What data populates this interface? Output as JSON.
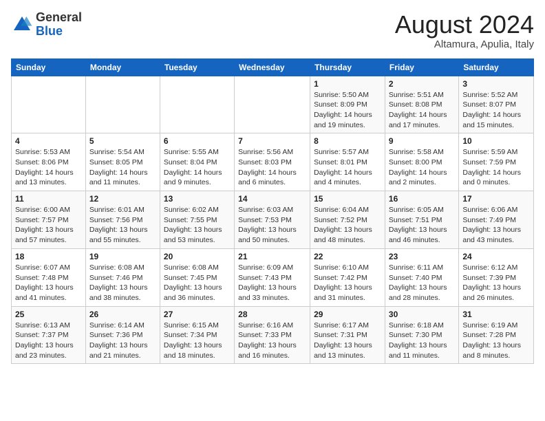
{
  "header": {
    "logo": {
      "general": "General",
      "blue": "Blue"
    },
    "title": "August 2024",
    "location": "Altamura, Apulia, Italy"
  },
  "weekdays": [
    "Sunday",
    "Monday",
    "Tuesday",
    "Wednesday",
    "Thursday",
    "Friday",
    "Saturday"
  ],
  "weeks": [
    [
      {
        "day": "",
        "info": ""
      },
      {
        "day": "",
        "info": ""
      },
      {
        "day": "",
        "info": ""
      },
      {
        "day": "",
        "info": ""
      },
      {
        "day": "1",
        "info": "Sunrise: 5:50 AM\nSunset: 8:09 PM\nDaylight: 14 hours and 19 minutes."
      },
      {
        "day": "2",
        "info": "Sunrise: 5:51 AM\nSunset: 8:08 PM\nDaylight: 14 hours and 17 minutes."
      },
      {
        "day": "3",
        "info": "Sunrise: 5:52 AM\nSunset: 8:07 PM\nDaylight: 14 hours and 15 minutes."
      }
    ],
    [
      {
        "day": "4",
        "info": "Sunrise: 5:53 AM\nSunset: 8:06 PM\nDaylight: 14 hours and 13 minutes."
      },
      {
        "day": "5",
        "info": "Sunrise: 5:54 AM\nSunset: 8:05 PM\nDaylight: 14 hours and 11 minutes."
      },
      {
        "day": "6",
        "info": "Sunrise: 5:55 AM\nSunset: 8:04 PM\nDaylight: 14 hours and 9 minutes."
      },
      {
        "day": "7",
        "info": "Sunrise: 5:56 AM\nSunset: 8:03 PM\nDaylight: 14 hours and 6 minutes."
      },
      {
        "day": "8",
        "info": "Sunrise: 5:57 AM\nSunset: 8:01 PM\nDaylight: 14 hours and 4 minutes."
      },
      {
        "day": "9",
        "info": "Sunrise: 5:58 AM\nSunset: 8:00 PM\nDaylight: 14 hours and 2 minutes."
      },
      {
        "day": "10",
        "info": "Sunrise: 5:59 AM\nSunset: 7:59 PM\nDaylight: 14 hours and 0 minutes."
      }
    ],
    [
      {
        "day": "11",
        "info": "Sunrise: 6:00 AM\nSunset: 7:57 PM\nDaylight: 13 hours and 57 minutes."
      },
      {
        "day": "12",
        "info": "Sunrise: 6:01 AM\nSunset: 7:56 PM\nDaylight: 13 hours and 55 minutes."
      },
      {
        "day": "13",
        "info": "Sunrise: 6:02 AM\nSunset: 7:55 PM\nDaylight: 13 hours and 53 minutes."
      },
      {
        "day": "14",
        "info": "Sunrise: 6:03 AM\nSunset: 7:53 PM\nDaylight: 13 hours and 50 minutes."
      },
      {
        "day": "15",
        "info": "Sunrise: 6:04 AM\nSunset: 7:52 PM\nDaylight: 13 hours and 48 minutes."
      },
      {
        "day": "16",
        "info": "Sunrise: 6:05 AM\nSunset: 7:51 PM\nDaylight: 13 hours and 46 minutes."
      },
      {
        "day": "17",
        "info": "Sunrise: 6:06 AM\nSunset: 7:49 PM\nDaylight: 13 hours and 43 minutes."
      }
    ],
    [
      {
        "day": "18",
        "info": "Sunrise: 6:07 AM\nSunset: 7:48 PM\nDaylight: 13 hours and 41 minutes."
      },
      {
        "day": "19",
        "info": "Sunrise: 6:08 AM\nSunset: 7:46 PM\nDaylight: 13 hours and 38 minutes."
      },
      {
        "day": "20",
        "info": "Sunrise: 6:08 AM\nSunset: 7:45 PM\nDaylight: 13 hours and 36 minutes."
      },
      {
        "day": "21",
        "info": "Sunrise: 6:09 AM\nSunset: 7:43 PM\nDaylight: 13 hours and 33 minutes."
      },
      {
        "day": "22",
        "info": "Sunrise: 6:10 AM\nSunset: 7:42 PM\nDaylight: 13 hours and 31 minutes."
      },
      {
        "day": "23",
        "info": "Sunrise: 6:11 AM\nSunset: 7:40 PM\nDaylight: 13 hours and 28 minutes."
      },
      {
        "day": "24",
        "info": "Sunrise: 6:12 AM\nSunset: 7:39 PM\nDaylight: 13 hours and 26 minutes."
      }
    ],
    [
      {
        "day": "25",
        "info": "Sunrise: 6:13 AM\nSunset: 7:37 PM\nDaylight: 13 hours and 23 minutes."
      },
      {
        "day": "26",
        "info": "Sunrise: 6:14 AM\nSunset: 7:36 PM\nDaylight: 13 hours and 21 minutes."
      },
      {
        "day": "27",
        "info": "Sunrise: 6:15 AM\nSunset: 7:34 PM\nDaylight: 13 hours and 18 minutes."
      },
      {
        "day": "28",
        "info": "Sunrise: 6:16 AM\nSunset: 7:33 PM\nDaylight: 13 hours and 16 minutes."
      },
      {
        "day": "29",
        "info": "Sunrise: 6:17 AM\nSunset: 7:31 PM\nDaylight: 13 hours and 13 minutes."
      },
      {
        "day": "30",
        "info": "Sunrise: 6:18 AM\nSunset: 7:30 PM\nDaylight: 13 hours and 11 minutes."
      },
      {
        "day": "31",
        "info": "Sunrise: 6:19 AM\nSunset: 7:28 PM\nDaylight: 13 hours and 8 minutes."
      }
    ]
  ]
}
